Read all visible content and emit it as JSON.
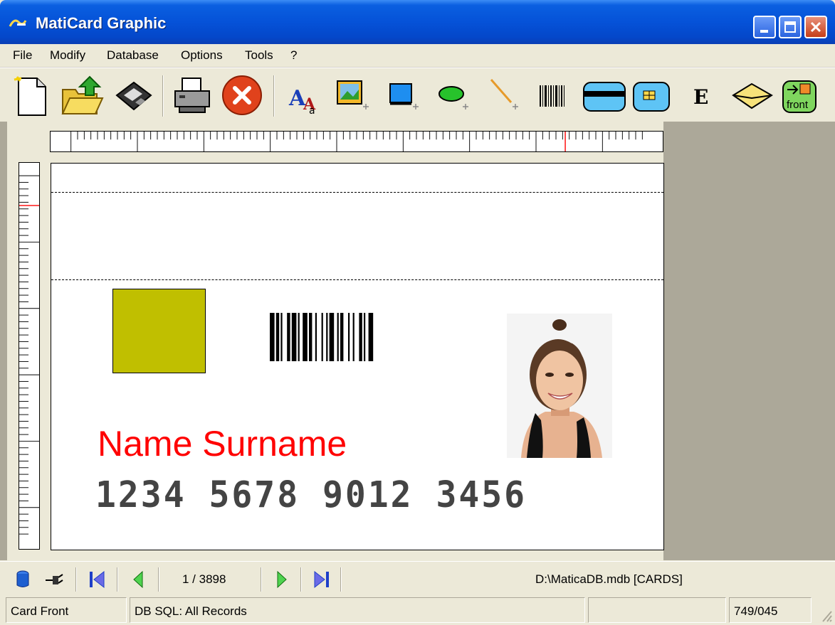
{
  "window": {
    "title": "MatiCard Graphic",
    "app_icon": "maticard-logo-icon",
    "controls": [
      "minimize-icon",
      "maximize-icon",
      "close-icon"
    ]
  },
  "menu": {
    "items": [
      "File",
      "Modify",
      "Database",
      "Options",
      "Tools",
      "?"
    ]
  },
  "toolbar": {
    "tools": [
      {
        "icon": "new-document-icon"
      },
      {
        "icon": "open-folder-icon"
      },
      {
        "icon": "save-disk-icon"
      },
      {
        "icon": "print-icon"
      },
      {
        "icon": "delete-icon"
      },
      {
        "icon": "text-tool-icon"
      },
      {
        "icon": "image-tool-icon"
      },
      {
        "icon": "rectangle-tool-icon"
      },
      {
        "icon": "ellipse-tool-icon"
      },
      {
        "icon": "line-tool-icon"
      },
      {
        "icon": "barcode-tool-icon"
      },
      {
        "icon": "magnetic-stripe-icon"
      },
      {
        "icon": "chip-card-icon"
      },
      {
        "icon": "encode-icon",
        "label": "E"
      },
      {
        "icon": "envelope-icon"
      },
      {
        "icon": "card-side-front-icon",
        "label": "front"
      }
    ]
  },
  "card": {
    "name_text": "Name Surname",
    "card_number": "1234 5678 9012 3456",
    "colors": {
      "rectangle": "#c0bf00",
      "name": "#ff0000",
      "number": "#444444"
    }
  },
  "navigation": {
    "record": "1 / 3898",
    "db_path": "D:\\MaticaDB.mdb [CARDS]"
  },
  "status": {
    "side": "Card Front",
    "query": "DB SQL: All Records",
    "empty": "",
    "code": "749/045"
  }
}
